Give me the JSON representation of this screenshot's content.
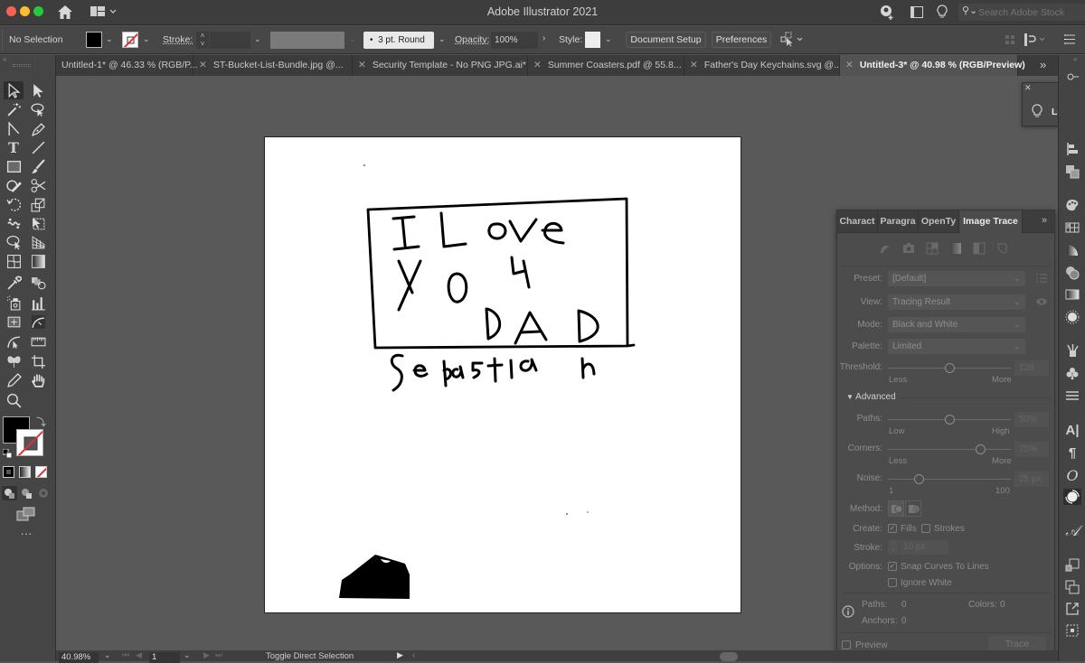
{
  "app": {
    "title": "Adobe Illustrator 2021",
    "search_placeholder": "Search Adobe Stock"
  },
  "control_bar": {
    "selection_label": "No Selection",
    "stroke_label": "Stroke:",
    "brush_value": "3 pt. Round",
    "opacity_label": "Opacity:",
    "opacity_value": "100%",
    "style_label": "Style:",
    "document_setup_label": "Document Setup",
    "preferences_label": "Preferences"
  },
  "tabs": [
    {
      "label": "Untitled-1* @ 46.33 % (RGB/P...",
      "active": false
    },
    {
      "label": "ST-Bucket-List-Bundle.jpg @...",
      "active": false
    },
    {
      "label": "Security Template - No PNG JPG.ai*",
      "active": false
    },
    {
      "label": "Summer Coasters.pdf @ 55.8...",
      "active": false
    },
    {
      "label": "Father's Day Keychains.svg @...",
      "active": false
    },
    {
      "label": "Untitled-3* @ 40.98 % (RGB/Preview)",
      "active": true
    }
  ],
  "tab_overflow": "»",
  "artwork": {
    "line1": "I Love",
    "line2": "You",
    "line3": "DAD",
    "signature": "Sebastian"
  },
  "learn_panel": {
    "label": "Learn"
  },
  "image_trace": {
    "tabs": [
      "Charact",
      "Paragra",
      "OpenTy",
      "Image Trace"
    ],
    "active_tab": "Image Trace",
    "preset_label": "Preset:",
    "preset_value": "[Default]",
    "view_label": "View:",
    "view_value": "Tracing Result",
    "mode_label": "Mode:",
    "mode_value": "Black and White",
    "palette_label": "Palette:",
    "palette_value": "Limited",
    "threshold_label": "Threshold:",
    "threshold_value": "128",
    "threshold_fraction": 0.5,
    "threshold_min": "Less",
    "threshold_max": "More",
    "advanced_label": "Advanced",
    "paths_label": "Paths:",
    "paths_value": "50%",
    "paths_fraction": 0.5,
    "paths_min": "Low",
    "paths_max": "High",
    "corners_label": "Corners:",
    "corners_value": "75%",
    "corners_fraction": 0.75,
    "corners_min": "Less",
    "corners_max": "More",
    "noise_label": "Noise:",
    "noise_value": "25 px",
    "noise_fraction": 0.25,
    "noise_min": "1",
    "noise_max": "100",
    "method_label": "Method:",
    "create_label": "Create:",
    "fills_label": "Fills",
    "fills_checked": true,
    "strokes_label": "Strokes",
    "strokes_checked": false,
    "stroke_label": "Stroke:",
    "stroke_value": "10 px",
    "options_label": "Options:",
    "snap_label": "Snap Curves To Lines",
    "snap_checked": true,
    "ignore_white_label": "Ignore White",
    "ignore_white_checked": false,
    "paths_count_label": "Paths:",
    "paths_count": "0",
    "colors_label": "Colors:",
    "colors_count": "0",
    "anchors_label": "Anchors:",
    "anchors_count": "0",
    "preview_label": "Preview",
    "preview_checked": false,
    "trace_label": "Trace"
  },
  "status": {
    "zoom": "40.98%",
    "artboard_number": "1",
    "tool_hint": "Toggle Direct Selection"
  },
  "colors": {
    "fill": "#000000",
    "stroke": "none",
    "accent_red": "#e03131"
  }
}
